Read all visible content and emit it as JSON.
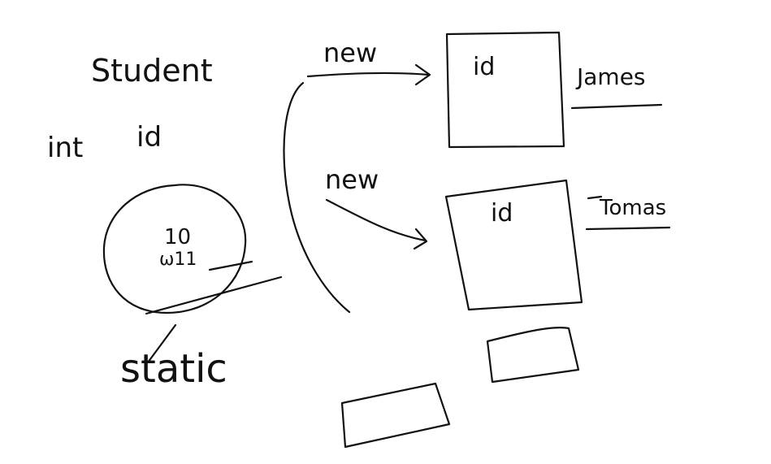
{
  "colors": {
    "ink": "#111111",
    "background": "#ffffff"
  },
  "labels": {
    "student": "Student",
    "int": "int",
    "id": "id",
    "circle_value": "10",
    "circle_value_2": "ω11",
    "static": "static",
    "new_1": "new",
    "new_2": "new",
    "box1_field": "id",
    "box2_field": "id",
    "name_1": "James",
    "name_2": "Tomas"
  }
}
